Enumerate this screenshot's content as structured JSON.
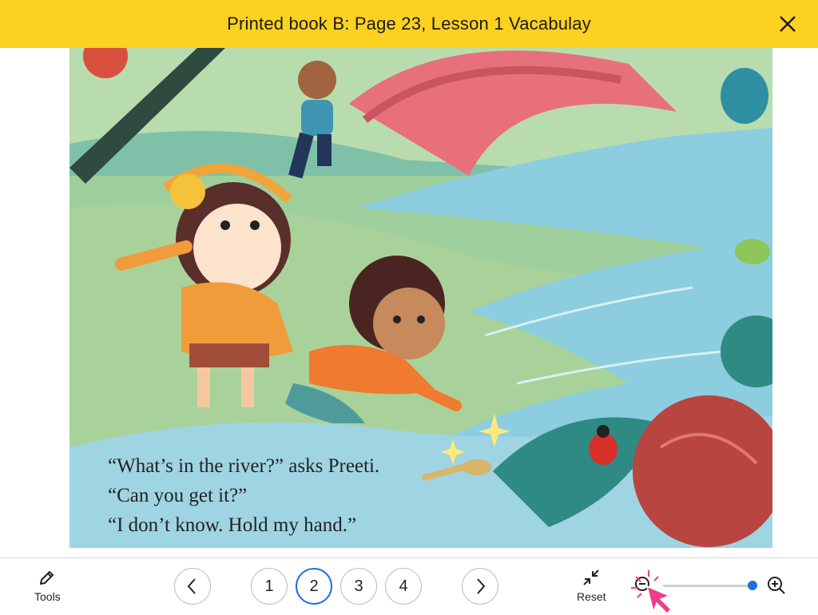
{
  "header": {
    "title": "Printed book B: Page 23, Lesson 1 Vacabulay"
  },
  "page": {
    "caption_lines": [
      "“What’s in the river?” asks Preeti.",
      "“Can you get it?”",
      "“I don’t know. Hold my hand.”"
    ]
  },
  "toolbar": {
    "tools_label": "Tools",
    "reset_label": "Reset",
    "pages": [
      "1",
      "2",
      "3",
      "4"
    ],
    "current_page": "2",
    "zoom_level": 1.0
  },
  "colors": {
    "header_bg": "#fdd11f",
    "accent": "#1f6fe0"
  },
  "icons": {
    "close": "close-icon",
    "tools": "pencil-icon",
    "prev": "chevron-left-icon",
    "next": "chevron-right-icon",
    "reset": "collapse-icon",
    "zoom_out": "zoom-out-icon",
    "zoom_in": "zoom-in-icon"
  }
}
